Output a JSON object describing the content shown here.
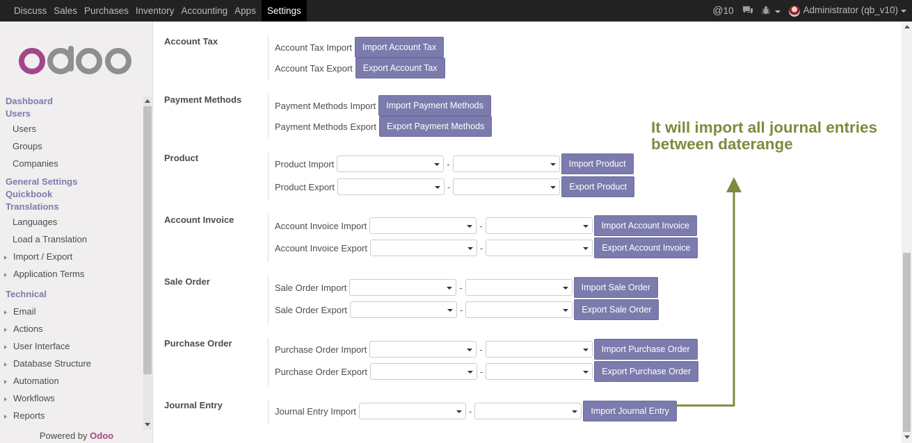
{
  "navbar": {
    "menu": [
      "Discuss",
      "Sales",
      "Purchases",
      "Inventory",
      "Accounting",
      "Apps",
      "Settings"
    ],
    "active": "Settings",
    "mentions": "10",
    "user": "Administrator (qb_v10)"
  },
  "sidebar": {
    "dashboard": "Dashboard",
    "users_header": "Users",
    "users_items": [
      "Users",
      "Groups",
      "Companies"
    ],
    "general_settings": "General Settings",
    "quickbook": "Quickbook",
    "translations": "Translations",
    "translation_items": [
      "Languages",
      "Load a Translation"
    ],
    "collapsible_1": [
      "Import / Export",
      "Application Terms"
    ],
    "technical": "Technical",
    "technical_items": [
      "Email",
      "Actions",
      "User Interface",
      "Database Structure",
      "Automation",
      "Workflows",
      "Reports"
    ],
    "powered_by": "Powered by",
    "powered_brand": "Odoo"
  },
  "sections": {
    "account_tax": {
      "title": "Account Tax",
      "import_label": "Account Tax Import",
      "import_btn": "Import Account Tax",
      "export_label": "Account Tax Export",
      "export_btn": "Export Account Tax"
    },
    "payment_methods": {
      "title": "Payment Methods",
      "import_label": "Payment Methods Import",
      "import_btn": "Import Payment Methods",
      "export_label": "Payment Methods Export",
      "export_btn": "Export Payment Methods"
    },
    "product": {
      "title": "Product",
      "import_label": "Product Import",
      "import_btn": "Import Product",
      "export_label": "Product Export",
      "export_btn": "Export Product"
    },
    "account_invoice": {
      "title": "Account Invoice",
      "import_label": "Account Invoice Import",
      "import_btn": "Import Account Invoice",
      "export_label": "Account Invoice Export",
      "export_btn": "Export Account Invoice"
    },
    "sale_order": {
      "title": "Sale Order",
      "import_label": "Sale Order Import",
      "import_btn": "Import Sale Order",
      "export_label": "Sale Order Export",
      "export_btn": "Export Sale Order"
    },
    "purchase_order": {
      "title": "Purchase Order",
      "import_label": "Purchase Order Import",
      "import_btn": "Import Purchase Order",
      "export_label": "Purchase Order Export",
      "export_btn": "Export Purchase Order"
    },
    "journal_entry": {
      "title": "Journal Entry",
      "import_label": "Journal Entry Import",
      "import_btn": "Import Journal Entry"
    }
  },
  "separator": "-",
  "annotation": {
    "line1": "It will import all journal entries",
    "line2": "between daterange",
    "color": "#7e8a3c"
  }
}
